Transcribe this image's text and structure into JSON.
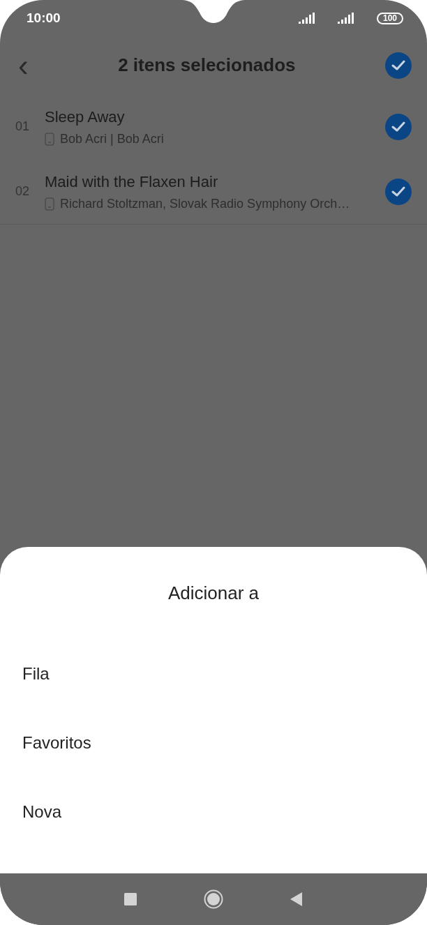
{
  "status_bar": {
    "time": "10:00",
    "battery": "100"
  },
  "header": {
    "back_icon": "‹",
    "title": "2 itens selecionados",
    "select_all": {
      "selected": true
    }
  },
  "tracks": [
    {
      "number": "01",
      "title": "Sleep Away",
      "subtitle": "Bob Acri | Bob Acri",
      "selected": true
    },
    {
      "number": "02",
      "title": "Maid with the Flaxen Hair",
      "subtitle": "Richard Stoltzman, Slovak Radio Symphony Orch…",
      "selected": true
    }
  ],
  "sheet": {
    "title": "Adicionar a",
    "options": [
      "Fila",
      "Favoritos",
      "Nova"
    ]
  }
}
